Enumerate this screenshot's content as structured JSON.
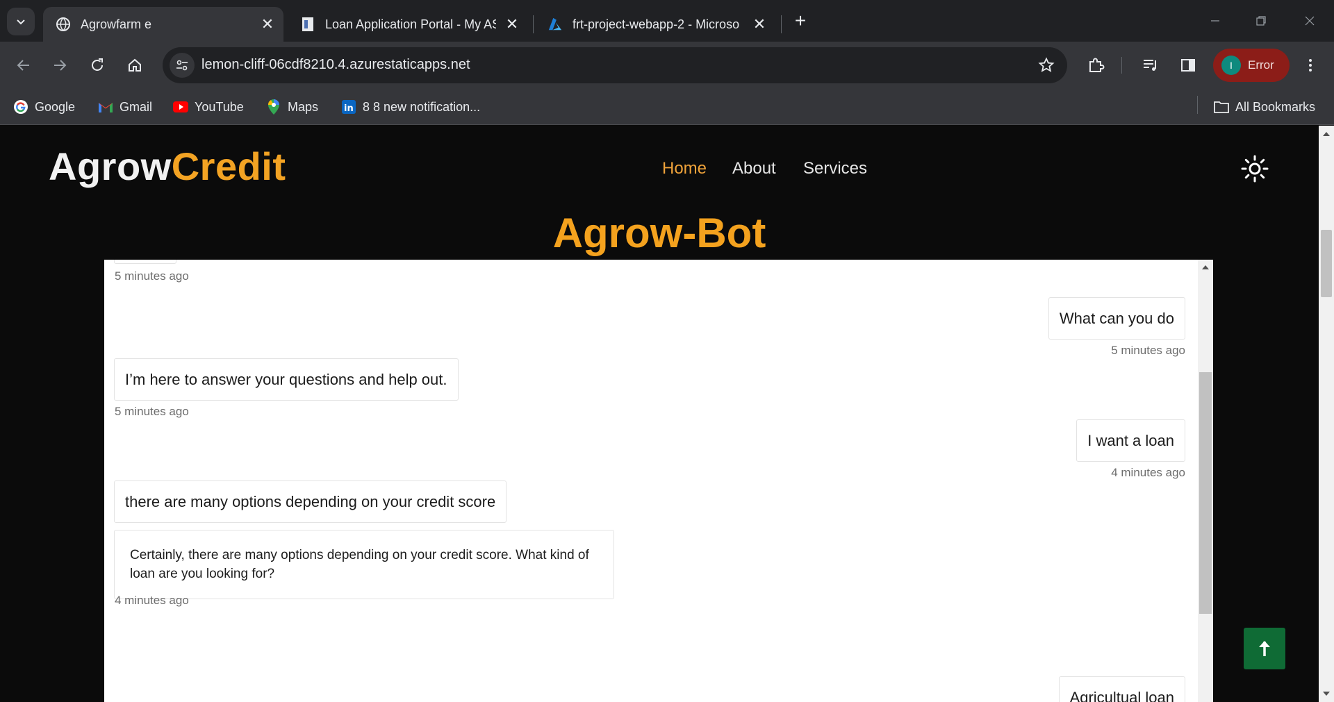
{
  "browser": {
    "tabs": [
      {
        "title": "Agrowfarm e",
        "active": true
      },
      {
        "title": "Loan Application Portal - My AS",
        "active": false
      },
      {
        "title": "frt-project-webapp-2 - Microso",
        "active": false
      }
    ],
    "url": "lemon-cliff-06cdf8210.4.azurestaticapps.net",
    "profile": {
      "initial": "I",
      "status": "Error"
    },
    "bookmarks": [
      {
        "label": "Google",
        "icon": "google-icon"
      },
      {
        "label": "Gmail",
        "icon": "gmail-icon"
      },
      {
        "label": "YouTube",
        "icon": "youtube-icon"
      },
      {
        "label": "Maps",
        "icon": "maps-icon"
      },
      {
        "label": "8 8 new notification...",
        "icon": "linkedin-icon"
      }
    ],
    "all_bookmarks": "All Bookmarks"
  },
  "site": {
    "logo_part1": "Agrow",
    "logo_part2": "Credit",
    "nav": [
      {
        "label": "Home",
        "active": true
      },
      {
        "label": "About",
        "active": false
      },
      {
        "label": "Services",
        "active": false
      }
    ],
    "bot_title": "Agrow-Bot"
  },
  "chat": {
    "messages": [
      {
        "sender": "bot",
        "text": "",
        "time": "5 minutes ago"
      },
      {
        "sender": "user",
        "text": "What can you do",
        "time": "5 minutes ago"
      },
      {
        "sender": "bot",
        "text": "I’m here to answer your questions and help out.",
        "time": "5 minutes ago"
      },
      {
        "sender": "user",
        "text": "I want a loan",
        "time": "4 minutes ago"
      },
      {
        "sender": "bot",
        "text": "there are many options depending on your credit score",
        "time": ""
      },
      {
        "sender": "bot",
        "text": "Certainly, there are many options depending on your credit score. What kind of loan are you looking for?",
        "time": "4 minutes ago"
      },
      {
        "sender": "user",
        "text": "Agricultual loan",
        "time": ""
      }
    ]
  },
  "colors": {
    "brand_orange": "#f3a323",
    "nav_active": "#f0a33a",
    "back_to_top": "#0f6b35",
    "profile_error": "#8c1d18"
  }
}
